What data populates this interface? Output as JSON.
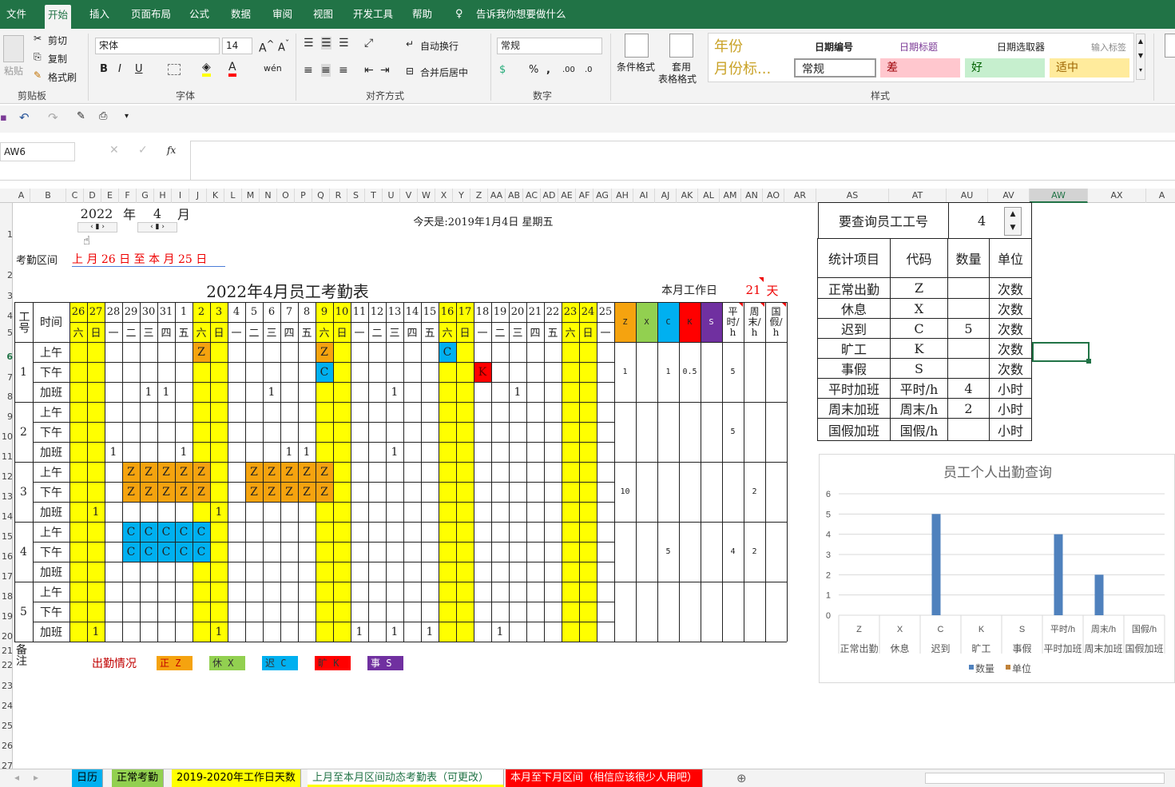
{
  "menubar": {
    "tabs": [
      "文件",
      "开始",
      "插入",
      "页面布局",
      "公式",
      "数据",
      "审阅",
      "视图",
      "开发工具",
      "帮助"
    ],
    "tell": "告诉我你想要做什么"
  },
  "ribbon": {
    "cut": "剪切",
    "copy": "复制",
    "paste": "粘贴",
    "format_painter": "格式刷",
    "font_name": "宋体",
    "font_size": "14",
    "wrap": "自动换行",
    "merge": "合并后居中",
    "number_format": "常规",
    "cond_format": "条件格式",
    "table_format": "套用",
    "table_format2": "表格格式",
    "groups": [
      "剪贴板",
      "字体",
      "对齐方式",
      "数字",
      "样式"
    ],
    "styles": {
      "s1": "年份",
      "s2": "月份标...",
      "s3": "日期编号",
      "s4": "日期标题",
      "s5": "日期选取器",
      "s6": "输入标签",
      "normal": "常规",
      "bad": "差",
      "good": "好",
      "neutral": "适中"
    }
  },
  "formula": {
    "name_box": "AW6",
    "fx": "fx"
  },
  "columns": [
    "A",
    "B",
    "C",
    "D",
    "E",
    "F",
    "G",
    "H",
    "I",
    "J",
    "K",
    "L",
    "M",
    "N",
    "O",
    "P",
    "Q",
    "R",
    "S",
    "T",
    "U",
    "V",
    "W",
    "X",
    "Y",
    "Z",
    "AA",
    "AB",
    "AC",
    "AD",
    "AE",
    "AF",
    "AG",
    "AH",
    "AI",
    "AJ",
    "AK",
    "AL",
    "AM",
    "AN",
    "AO",
    "AR",
    "AS",
    "AT",
    "AU",
    "AV",
    "AW",
    "AX",
    "A"
  ],
  "rows": [
    "1",
    "2",
    "3",
    "4",
    "5",
    "6",
    "7",
    "8",
    "9",
    "10",
    "11",
    "12",
    "13",
    "14",
    "15",
    "16",
    "17",
    "18",
    "19",
    "20",
    "21",
    "22",
    "23",
    "24",
    "25",
    "26",
    "27"
  ],
  "sheet": {
    "year": "2022",
    "year_unit": "年",
    "month": "4",
    "month_unit": "月",
    "today": "今天是:2019年1月4日 星期五",
    "period_label": "考勤区间",
    "period": "上 月 26 日 至 本 月 25 日",
    "title": "2022年4月员工考勤表",
    "workdays_label": "本月工作日",
    "workdays": "21",
    "workdays_unit": "天",
    "hdr_id": "工号",
    "hdr_time": "时间",
    "days": [
      "26",
      "27",
      "28",
      "29",
      "30",
      "31",
      "1",
      "2",
      "3",
      "4",
      "5",
      "6",
      "7",
      "8",
      "9",
      "10",
      "11",
      "12",
      "13",
      "14",
      "15",
      "16",
      "17",
      "18",
      "19",
      "20",
      "21",
      "22",
      "23",
      "24",
      "25"
    ],
    "weekdays": [
      "六",
      "日",
      "一",
      "二",
      "三",
      "四",
      "五",
      "六",
      "日",
      "一",
      "二",
      "三",
      "四",
      "五",
      "六",
      "日",
      "一",
      "二",
      "三",
      "四",
      "五",
      "六",
      "日",
      "一",
      "二",
      "三",
      "四",
      "五",
      "六",
      "日",
      "一"
    ],
    "stat_headers": [
      "Z",
      "X",
      "C",
      "K",
      "S",
      "平时/h",
      "周末/h",
      "国假/h"
    ],
    "periods": [
      "上午",
      "下午",
      "加班"
    ],
    "employees": [
      "1",
      "2",
      "3",
      "4",
      "5"
    ],
    "remark": "备注",
    "legend_title": "出勤情况",
    "legend": [
      "正 Z",
      "休 X",
      "迟 C",
      "旷 K",
      "事 S"
    ]
  },
  "query": {
    "label": "要查询员工工号",
    "value": "4",
    "headers": [
      "统计项目",
      "代码",
      "数量",
      "单位"
    ],
    "rows": [
      [
        "正常出勤",
        "Z",
        "",
        "次数"
      ],
      [
        "休息",
        "X",
        "",
        "次数"
      ],
      [
        "迟到",
        "C",
        "5",
        "次数"
      ],
      [
        "旷工",
        "K",
        "",
        "次数"
      ],
      [
        "事假",
        "S",
        "",
        "次数"
      ],
      [
        "平时加班",
        "平时/h",
        "4",
        "小时"
      ],
      [
        "周末加班",
        "周末/h",
        "2",
        "小时"
      ],
      [
        "国假加班",
        "国假/h",
        "",
        "小时"
      ]
    ]
  },
  "chart_data": {
    "type": "bar",
    "title": "员工个人出勤查询",
    "categories": [
      "Z",
      "X",
      "C",
      "K",
      "S",
      "平时/h",
      "周末/h",
      "国假/h"
    ],
    "category_names": [
      "正常出勤",
      "休息",
      "迟到",
      "旷工",
      "事假",
      "平时加班",
      "周末加班",
      "国假加班"
    ],
    "series": [
      {
        "name": "数量",
        "values": [
          0,
          0,
          5,
          0,
          0,
          4,
          2,
          0
        ]
      },
      {
        "name": "单位",
        "values": [
          0,
          0,
          0,
          0,
          0,
          0,
          0,
          0
        ]
      }
    ],
    "ylim": [
      0,
      6
    ],
    "yticks": [
      "0",
      "1",
      "2",
      "3",
      "4",
      "5",
      "6"
    ],
    "legend": "bottom",
    "colors": [
      "#4f81bd",
      "#c0823a"
    ]
  },
  "sheet_tabs": [
    "日历",
    "正常考勤",
    "2019-2020年工作日天数",
    "上月至本月区间动态考勤表（可更改）",
    "本月至下月区间（相信应该很少人用吧）"
  ],
  "colors": {
    "excel_green": "#217346",
    "yellow": "#ffff00",
    "orange": "#f5a30f",
    "green": "#92d050",
    "blue": "#00b0f0",
    "red": "#ff0000",
    "purple": "#7030a0"
  }
}
